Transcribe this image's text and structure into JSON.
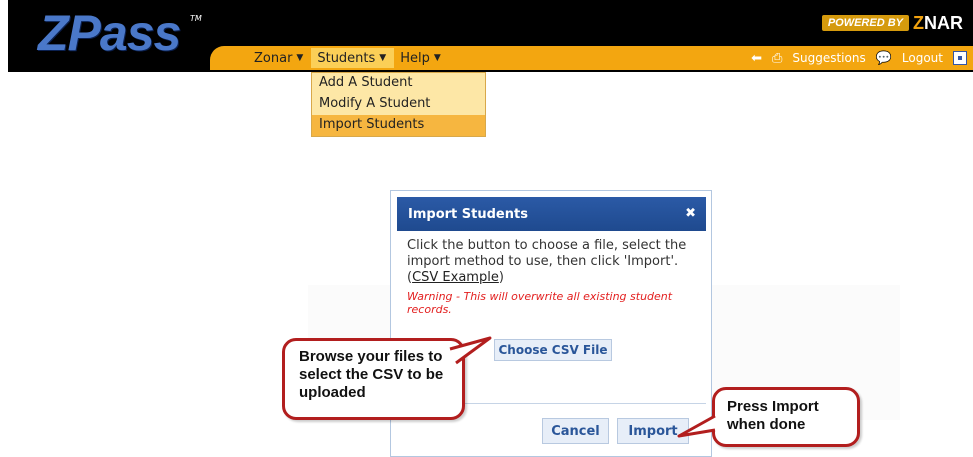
{
  "header": {
    "logo": "ZPass",
    "logo_tm": "TM",
    "powered_by": "POWERED BY",
    "brand_z": "Z",
    "brand_rest": "NAR"
  },
  "nav": {
    "items": [
      {
        "label": "Zonar"
      },
      {
        "label": "Students"
      },
      {
        "label": "Help"
      }
    ],
    "suggestions_label": "Suggestions",
    "logout_label": "Logout"
  },
  "dropdown": {
    "items": [
      {
        "label": "Add A Student"
      },
      {
        "label": "Modify A Student"
      },
      {
        "label": "Import Students"
      }
    ]
  },
  "dialog": {
    "title": "Import Students",
    "instructions_prefix": "Click the button to choose a file, select the import method to use, then click 'Import'. (",
    "csv_example_link": "CSV Example",
    "instructions_suffix": ")",
    "warning": "Warning - This will overwrite all existing student records.",
    "choose_button": "Choose CSV File",
    "cancel_button": "Cancel",
    "import_button": "Import"
  },
  "callouts": {
    "browse": "Browse your files to select the CSV to be uploaded",
    "import": "Press Import when done"
  },
  "colors": {
    "nav_bar": "#f3a610",
    "dialog_title": "#2b5aa6",
    "callout_border": "#b21e1e",
    "warning_text": "#e32020"
  }
}
